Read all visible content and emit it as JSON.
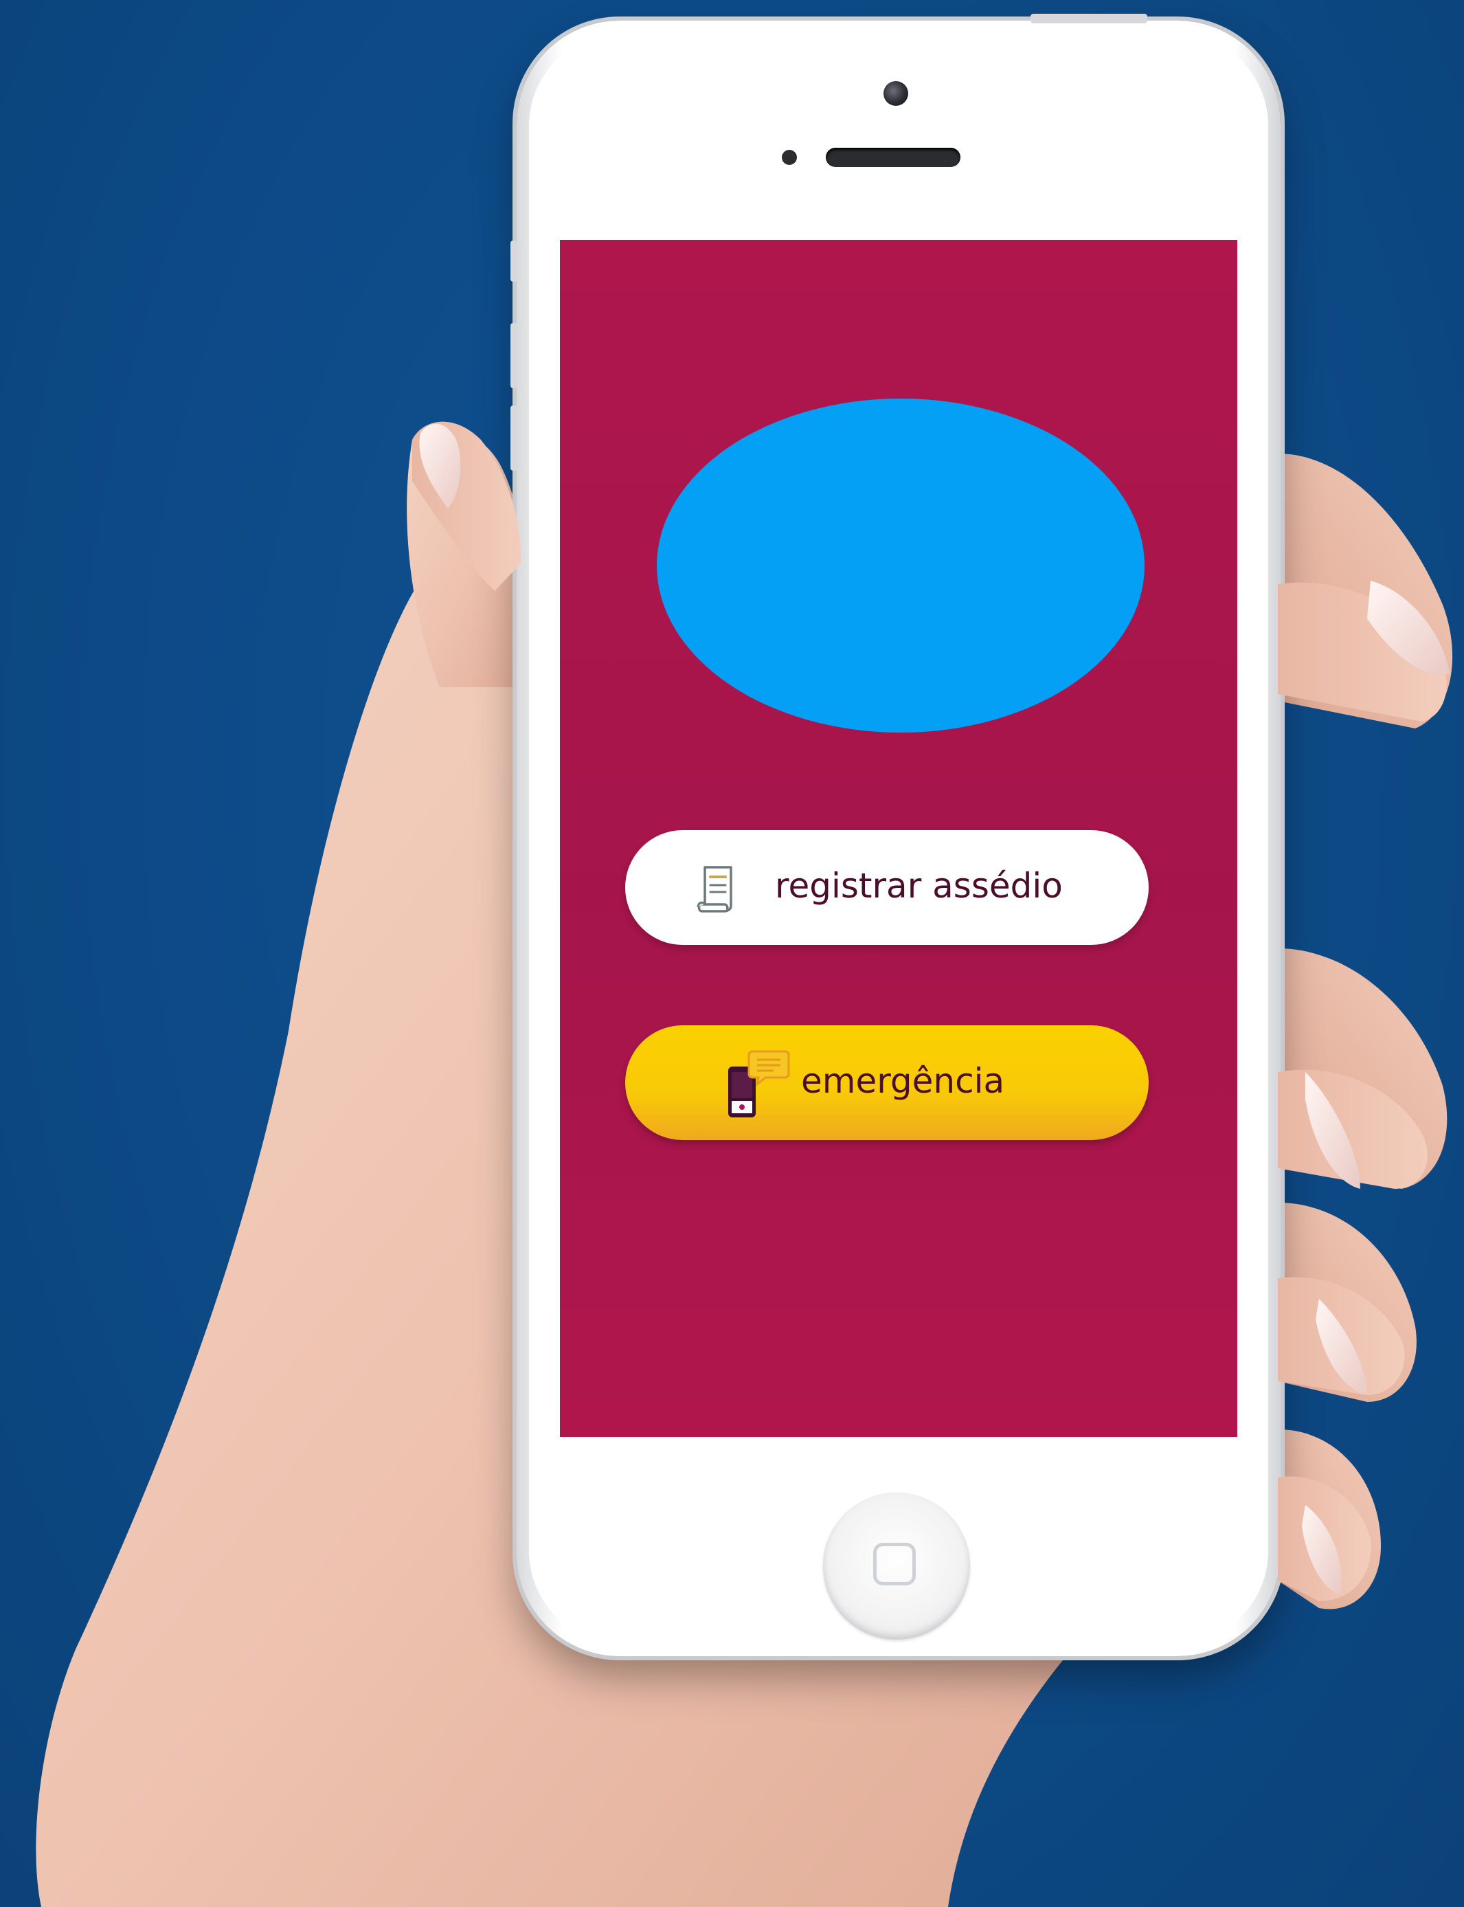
{
  "screen": {
    "background_color": "#ae164c",
    "logo_color": "#04a0f5",
    "buttons": {
      "register": {
        "label": "registrar assédio",
        "icon": "document-scroll-icon"
      },
      "emergency": {
        "label": "emergência",
        "icon": "phone-message-icon"
      }
    }
  },
  "device": {
    "home_button_icon": "home-button-icon"
  },
  "colors": {
    "background": "#0e4c88",
    "button_text": "#4a0e2b",
    "register_bg": "#ffffff",
    "emergency_bg": "#fbd100"
  }
}
